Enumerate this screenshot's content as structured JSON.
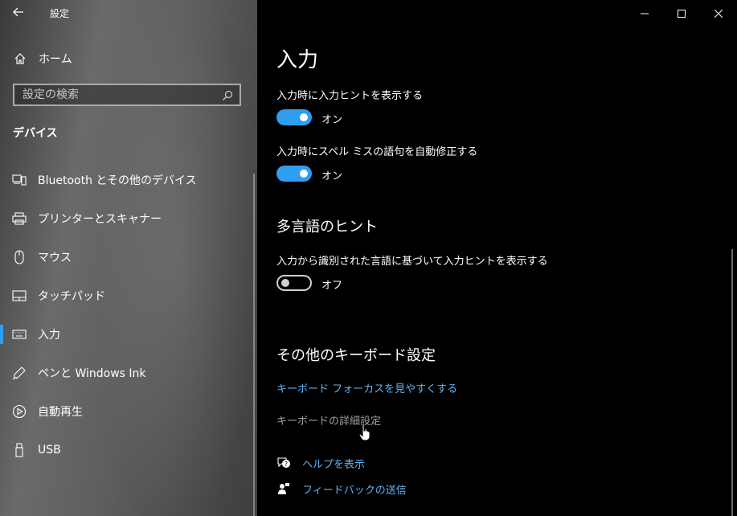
{
  "window": {
    "title": "設定"
  },
  "sidebar": {
    "home_label": "ホーム",
    "search_placeholder": "設定の検索",
    "section_title": "デバイス",
    "items": [
      {
        "label": "Bluetooth とその他のデバイス",
        "icon": "bluetooth-devices-icon"
      },
      {
        "label": "プリンターとスキャナー",
        "icon": "printer-icon"
      },
      {
        "label": "マウス",
        "icon": "mouse-icon"
      },
      {
        "label": "タッチパッド",
        "icon": "touchpad-icon"
      },
      {
        "label": "入力",
        "icon": "keyboard-icon",
        "selected": true
      },
      {
        "label": "ペンと Windows Ink",
        "icon": "pen-icon"
      },
      {
        "label": "自動再生",
        "icon": "autoplay-icon"
      },
      {
        "label": "USB",
        "icon": "usb-icon"
      }
    ]
  },
  "main": {
    "page_title": "入力",
    "settings": [
      {
        "label": "入力時に入力ヒントを表示する",
        "state": "オン",
        "on": true
      },
      {
        "label": "入力時にスペル ミスの語句を自動修正する",
        "state": "オン",
        "on": true
      }
    ],
    "multilingual": {
      "heading": "多言語のヒント",
      "label": "入力から識別された言語に基づいて入力ヒントを表示する",
      "state": "オフ",
      "on": false
    },
    "other_keyboard": {
      "heading": "その他のキーボード設定",
      "link_focus": "キーボード フォーカスを見やすくする",
      "link_advanced": "キーボードの詳細設定"
    },
    "help": {
      "show_help": "ヘルプを表示",
      "send_feedback": "フィードバックの送信"
    }
  },
  "colors": {
    "accent": "#2e9df2",
    "link": "#5fb3f5"
  }
}
